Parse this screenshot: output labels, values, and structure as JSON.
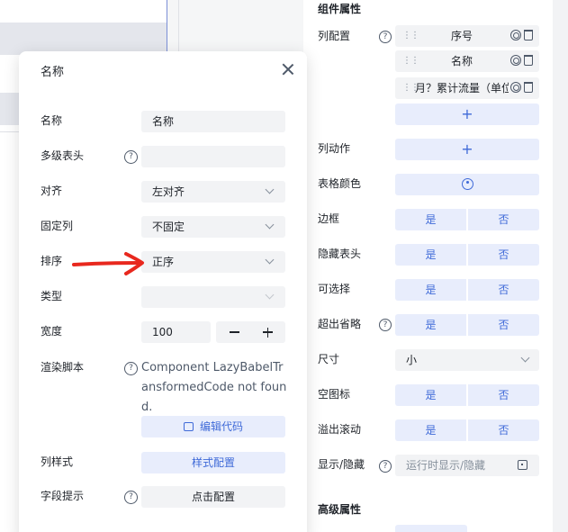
{
  "colors": {
    "accent": "#3f6ad8",
    "accent_bg": "#e8edfc",
    "field_bg": "#f2f3f5",
    "annotation": "#e8281e"
  },
  "panel": {
    "section_component": "组件属性",
    "section_advanced": "高级属性",
    "column_config": {
      "label": "列配置",
      "columns": [
        "序号",
        "名称",
        "月？累计流量（单位"
      ],
      "add_symbol": "+"
    },
    "column_action": {
      "label": "列动作",
      "add_symbol": "+"
    },
    "table_color": {
      "label": "表格颜色",
      "icon": "palette-icon"
    },
    "border": {
      "label": "边框",
      "yes": "是",
      "no": "否"
    },
    "hide_header": {
      "label": "隐藏表头",
      "yes": "是",
      "no": "否"
    },
    "selectable": {
      "label": "可选择",
      "yes": "是",
      "no": "否"
    },
    "ellipsis": {
      "label": "超出省略",
      "yes": "是",
      "no": "否"
    },
    "size": {
      "label": "尺寸",
      "value": "小"
    },
    "empty_icon": {
      "label": "空图标",
      "yes": "是",
      "no": "否"
    },
    "overflow_scroll": {
      "label": "溢出滚动",
      "yes": "是",
      "no": "否"
    },
    "show_hide": {
      "label": "显示/隐藏",
      "placeholder": "运行时显示/隐藏"
    }
  },
  "modal": {
    "title": "名称",
    "fields": {
      "name": {
        "label": "名称",
        "value": "名称"
      },
      "multi_header": {
        "label": "多级表头",
        "value": ""
      },
      "align": {
        "label": "对齐",
        "value": "左对齐"
      },
      "fixed_column": {
        "label": "固定列",
        "value": "不固定"
      },
      "sort": {
        "label": "排序",
        "value": "正序"
      },
      "type": {
        "label": "类型",
        "value": ""
      },
      "width": {
        "label": "宽度",
        "value": "100"
      },
      "render_script": {
        "label": "渲染脚本",
        "text": "Component LazyBabelTransformedCode not found.",
        "button": "编辑代码"
      },
      "column_style": {
        "label": "列样式",
        "button": "样式配置"
      },
      "field_tip": {
        "label": "字段提示",
        "button": "点击配置"
      }
    }
  }
}
